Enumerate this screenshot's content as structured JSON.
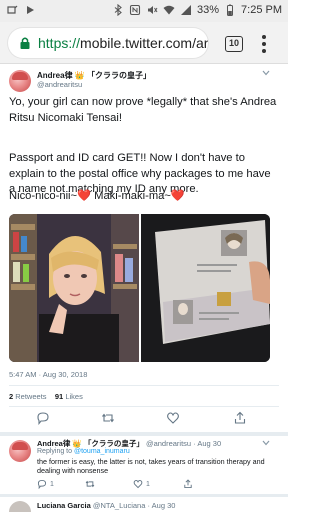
{
  "status_bar": {
    "battery": "33%",
    "time": "7:25 PM"
  },
  "browser": {
    "url_scheme": "https://",
    "url_host": "mobile.twitter.com/ar",
    "tab_count": "10"
  },
  "tweet": {
    "author_name": "Andrea律 👑 「クララの皇子」",
    "author_handle": "@andrearitsu",
    "paragraph_1": "Yo, your girl can now prove *legally* that she's Andrea Ritsu Nicomaki Tensai!",
    "paragraph_2": "Passport and ID card GET!! Now I don't have to explain to the postal office why packages to me have a name not matching my ID any more.",
    "paragraph_3a": "Nico-nico-nii~",
    "paragraph_3b": " Maki-maki-ma~",
    "heart_glyph": "❤️",
    "timestamp": "5:47 AM · Aug 30, 2018",
    "retweets_count": "2",
    "retweets_label": "Retweets",
    "likes_count": "91",
    "likes_label": "Likes"
  },
  "reply": {
    "author_name": "Andrea律 👑 「クララの皇子」",
    "author_handle": "@andrearitsu",
    "date": "Aug 30",
    "replying_prefix": "Replying to",
    "replying_mention": "@touma_inumaru",
    "text": "the former is easy, the latter is not, takes years of transition therapy and dealing with nonsense",
    "reply_count": "1",
    "like_count": "1"
  },
  "next_reply": {
    "author_name": "Luciana Garcia",
    "author_handle": "@NTA_Luciana",
    "date": "Aug 30"
  },
  "colors": {
    "twitter_blue": "#1da1f2",
    "secure_green": "#0b8043",
    "heart_red": "#d0132d",
    "muted_text": "#657786"
  }
}
